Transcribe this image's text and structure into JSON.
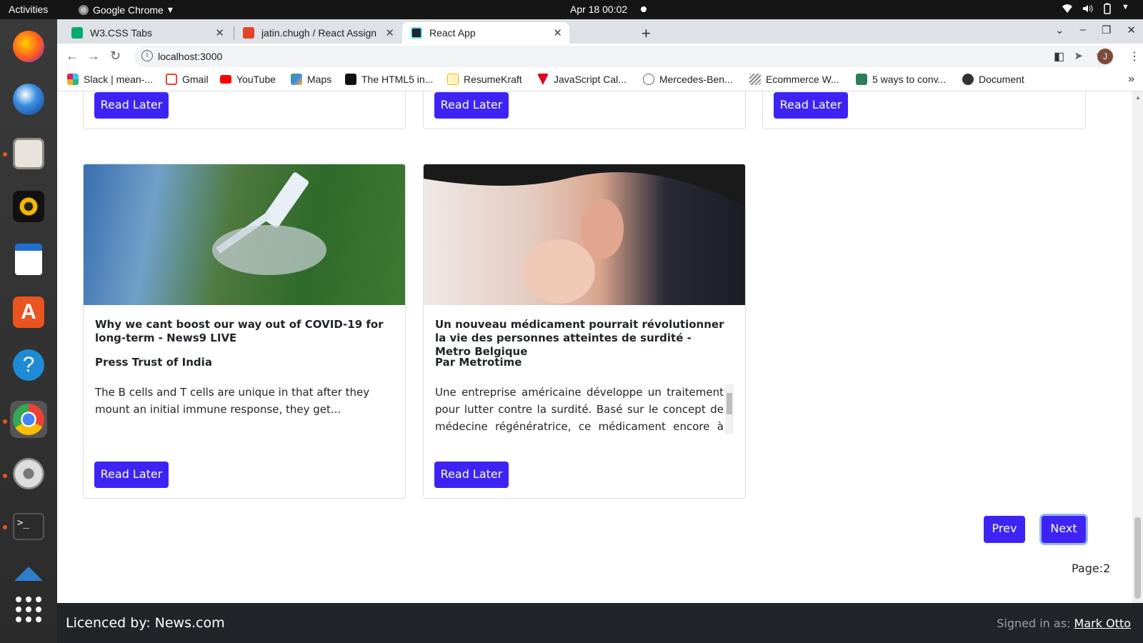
{
  "system_bar": {
    "activities": "Activities",
    "app_name": "Google Chrome",
    "clock": "Apr 18  00:02"
  },
  "dock": {
    "items": [
      "firefox-icon",
      "thunderbird-icon",
      "files-icon",
      "rhythmbox-icon",
      "writer-icon",
      "software-icon",
      "help-icon",
      "chrome-icon",
      "settings-icon",
      "terminal-icon",
      "show-apps-icon"
    ]
  },
  "browser": {
    "tabs": [
      {
        "label": "W3.CSS Tabs",
        "active": false
      },
      {
        "label": "jatin.chugh / React Assign",
        "active": false
      },
      {
        "label": "React App",
        "active": true
      }
    ],
    "url": "localhost:3000",
    "profile_initial": "J",
    "bookmarks": [
      "Slack | mean-...",
      "Gmail",
      "YouTube",
      "Maps",
      "The HTML5 in...",
      "ResumeKraft",
      "JavaScript Cal...",
      "Mercedes-Ben...",
      "Ecommerce W...",
      "5 ways to conv...",
      "Document"
    ]
  },
  "page": {
    "read_later_label": "Read Later",
    "cards": [
      {
        "title": "Why we cant boost our way out of COVID-19 for long-term - News9 LIVE",
        "author": "Press Trust of India",
        "description": "The B cells and T cells are unique in that after they mount an initial immune response, they get...",
        "image": "vaccine-syringe-image"
      },
      {
        "title": "Un nouveau médicament pourrait révolutionner la vie des personnes atteintes de surdité - Metro Belgique",
        "author": "Par Metrotime",
        "description": "Une entreprise américaine développe un traitement pour lutter contre la surdité. Basé sur le concept de médecine régénératrice, ce médicament encore à l'essai",
        "image": "woman-ear-image"
      }
    ],
    "pagination": {
      "prev_label": "Prev",
      "next_label": "Next",
      "page_label": "Page:2"
    }
  },
  "footer": {
    "licence": "Licenced by: News.com",
    "signed_in_prefix": "Signed in as: ",
    "user": "Mark Otto"
  },
  "colors": {
    "primary_button": "#3d24f5",
    "footer_bg": "#212529"
  }
}
